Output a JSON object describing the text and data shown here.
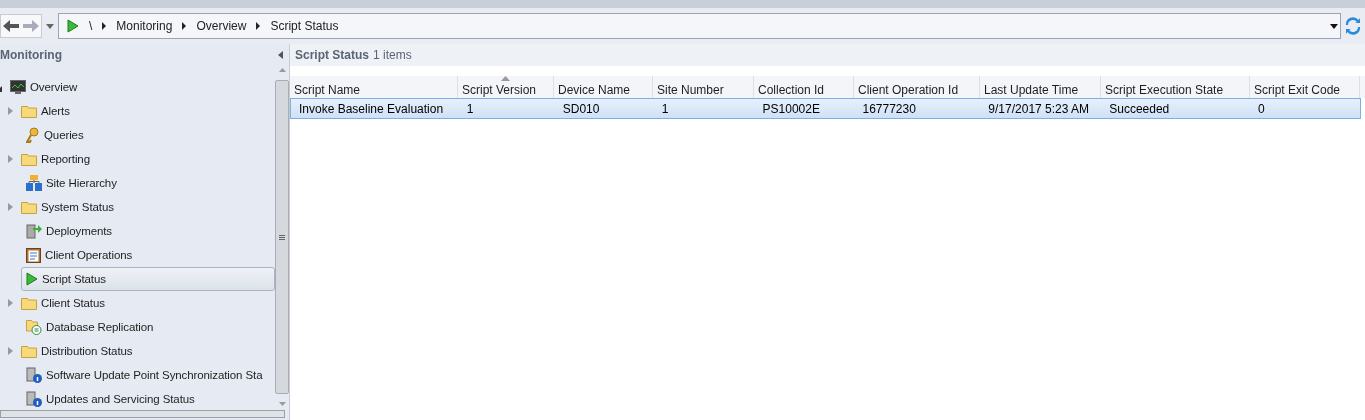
{
  "breadcrumb": [
    "\\",
    "Monitoring",
    "Overview",
    "Script Status"
  ],
  "navigation": {
    "title": "Monitoring",
    "tree": [
      {
        "label": "Overview",
        "kind": "monitor",
        "expanded": true,
        "selected": false,
        "children": [
          {
            "label": "Alerts",
            "kind": "folder",
            "expanded": false,
            "selected": false
          },
          {
            "label": "Queries",
            "kind": "key",
            "selected": false
          },
          {
            "label": "Reporting",
            "kind": "folder",
            "expanded": false,
            "selected": false
          },
          {
            "label": "Site Hierarchy",
            "kind": "hierarchy",
            "selected": false
          },
          {
            "label": "System Status",
            "kind": "folder",
            "expanded": false,
            "selected": false
          },
          {
            "label": "Deployments",
            "kind": "deploy",
            "selected": false
          },
          {
            "label": "Client Operations",
            "kind": "clipboard",
            "selected": false
          },
          {
            "label": "Script Status",
            "kind": "play",
            "selected": true
          },
          {
            "label": "Client Status",
            "kind": "folder",
            "expanded": false,
            "selected": false
          },
          {
            "label": "Database Replication",
            "kind": "replication",
            "selected": false
          },
          {
            "label": "Distribution Status",
            "kind": "folder",
            "expanded": false,
            "selected": false
          },
          {
            "label": "Software Update Point Synchronization Sta",
            "kind": "server-info",
            "selected": false
          },
          {
            "label": "Updates and Servicing Status",
            "kind": "server-info",
            "selected": false
          }
        ]
      }
    ]
  },
  "results": {
    "title": "Script Status",
    "count": "1 items",
    "columns": [
      {
        "label": "Script Name",
        "sorted": false
      },
      {
        "label": "Script Version",
        "sorted": true
      },
      {
        "label": "Device Name",
        "sorted": false
      },
      {
        "label": "Site Number",
        "sorted": false
      },
      {
        "label": "Collection Id",
        "sorted": false
      },
      {
        "label": "Client Operation Id",
        "sorted": false
      },
      {
        "label": "Last Update Time",
        "sorted": false
      },
      {
        "label": "Script Execution State",
        "sorted": false
      },
      {
        "label": "Script Exit Code",
        "sorted": false
      }
    ],
    "rows": [
      {
        "selected": true,
        "cells": [
          "Invoke Baseline Evaluation",
          "1",
          "SD010",
          "1",
          "PS10002E",
          "16777230",
          "9/17/2017 5:23 AM",
          "Succeeded",
          "0"
        ]
      }
    ]
  }
}
